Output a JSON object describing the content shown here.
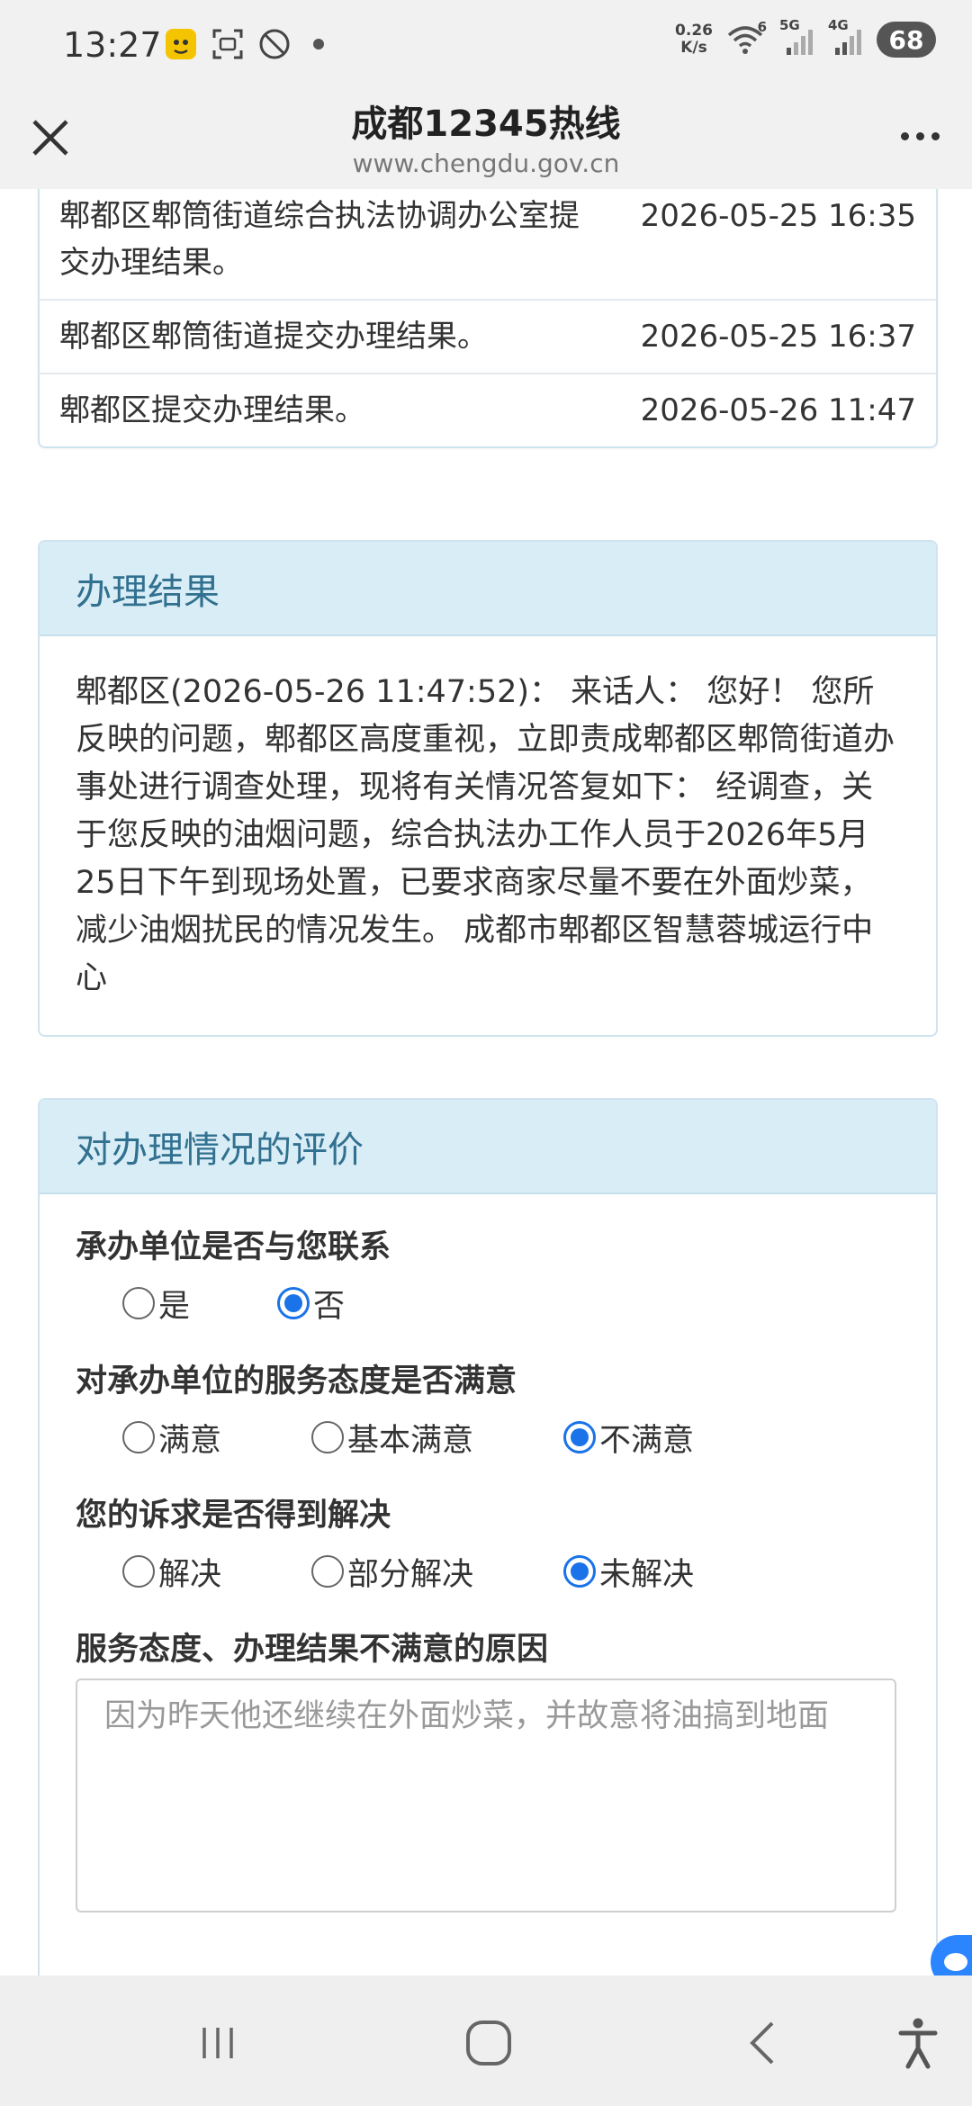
{
  "status_bar": {
    "time": "13:27",
    "net_speed_value": "0.26",
    "net_speed_unit": "K/s",
    "wifi_label": "6",
    "signal1_label": "5G",
    "signal2_label": "4G",
    "battery": "68"
  },
  "header": {
    "title": "成都12345热线",
    "subtitle": "www.chengdu.gov.cn"
  },
  "progress_log": [
    {
      "desc": "郫都区郫筒街道综合执法协调办公室提交办理结果。",
      "time": "2026-05-25 16:35"
    },
    {
      "desc": "郫都区郫筒街道提交办理结果。",
      "time": "2026-05-25 16:37"
    },
    {
      "desc": "郫都区提交办理结果。",
      "time": "2026-05-26 11:47"
    }
  ],
  "result_card": {
    "heading": "办理结果",
    "text": "郫都区(2026-05-26 11:47:52)： 来话人： 您好！ 您所反映的问题，郫都区高度重视，立即责成郫都区郫筒街道办事处进行调查处理，现将有关情况答复如下： 经调查，关于您反映的油烟问题，综合执法办工作人员于2026年5月25日下午到现场处置，已要求商家尽量不要在外面炒菜，减少油烟扰民的情况发生。 成都市郫都区智慧蓉城运行中心"
  },
  "evaluation": {
    "heading": "对办理情况的评价",
    "q1": {
      "label": "承办单位是否与您联系",
      "options": [
        "是",
        "否"
      ],
      "selected": "否"
    },
    "q2": {
      "label": "对承办单位的服务态度是否满意",
      "options": [
        "满意",
        "基本满意",
        "不满意"
      ],
      "selected": "不满意"
    },
    "q3": {
      "label": "您的诉求是否得到解决",
      "options": [
        "解决",
        "部分解决",
        "未解决"
      ],
      "selected": "未解决"
    },
    "reason_label": "服务态度、办理结果不满意的原因",
    "reason_value": "因为昨天他还继续在外面炒菜，并故意将油搞到地面"
  },
  "colors": {
    "card_header_bg": "#d9edf7",
    "card_header_text": "#31708f",
    "radio_checked": "#1a73e8"
  }
}
